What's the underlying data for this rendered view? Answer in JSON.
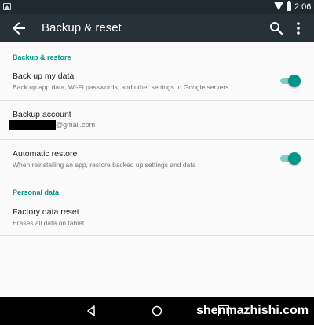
{
  "status_bar": {
    "time": "2:06"
  },
  "app_bar": {
    "title": "Backup & reset"
  },
  "sections": [
    {
      "header": "Backup & restore"
    },
    {
      "header": "Personal data"
    }
  ],
  "items": {
    "backup_data": {
      "title": "Back up my data",
      "subtitle": "Back up app data, Wi-Fi passwords, and other settings to Google servers",
      "enabled": true
    },
    "backup_account": {
      "title": "Backup account",
      "email_suffix": "@gmail.com"
    },
    "auto_restore": {
      "title": "Automatic restore",
      "subtitle": "When reinstalling an app, restore backed up settings and data",
      "enabled": true
    },
    "factory_reset": {
      "title": "Factory data reset",
      "subtitle": "Erases all data on tablet"
    }
  },
  "watermark": "shenmazhishi.com",
  "colors": {
    "accent": "#009688",
    "app_bar": "#263238",
    "status_bar": "#1f2a2e"
  },
  "icons": [
    "image-icon",
    "wifi-icon",
    "battery-icon",
    "back-arrow-icon",
    "search-icon",
    "more-vert-icon",
    "nav-back-icon",
    "nav-home-icon",
    "nav-recents-icon"
  ]
}
